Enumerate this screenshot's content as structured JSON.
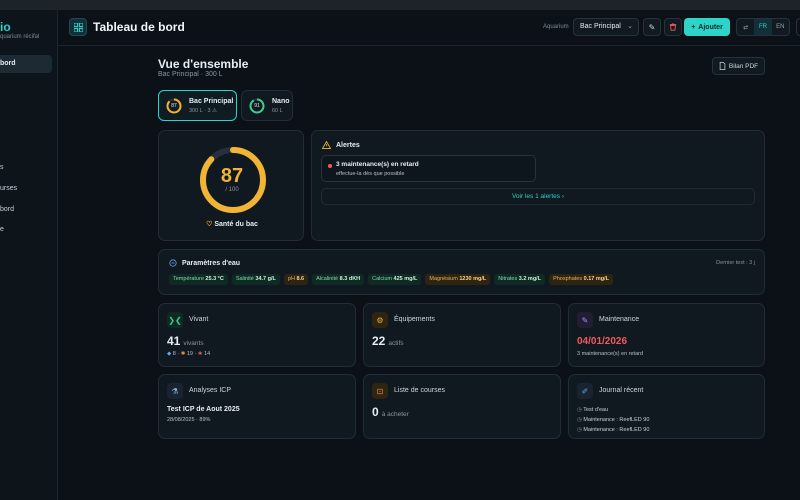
{
  "sidebar": {
    "brand": "io",
    "brand_sub": "quarium récifal",
    "items": [
      "bord",
      "",
      "s",
      "urses",
      "bord",
      "e"
    ]
  },
  "header": {
    "title": "Tableau de bord",
    "aquarium_label": "Aquarium",
    "aquarium_selected": "Bac Principal",
    "add_label": "Ajouter",
    "lang_fr": "FR",
    "lang_en": "EN"
  },
  "overview": {
    "title": "Vue d'ensemble",
    "subtitle": "Bac Principal · 300 L",
    "pdf_label": "Bilan PDF"
  },
  "tanks": [
    {
      "score": "87",
      "name": "Bac Principal",
      "meta": "300 L · 3 ⚠",
      "score_fraction": 0.87,
      "color": "#f2b434"
    },
    {
      "score": "91",
      "name": "Nano",
      "meta": "60 L",
      "score_fraction": 0.91,
      "color": "#3ecf8e"
    }
  ],
  "health": {
    "score": "87",
    "max": "/ 100",
    "score_fraction": 0.87,
    "label": "Santé du bac",
    "color": "#f2b434"
  },
  "alerts": {
    "title": "Alertes",
    "item_title": "3 maintenance(s) en retard",
    "item_sub": "effectue-la dès que possible",
    "link": "Voir les 1 alertes"
  },
  "params": {
    "title": "Paramètres d'eau",
    "last_test": "Dernier test : 3 j",
    "chips": [
      {
        "label": "Température",
        "value": "25.3 °C",
        "status": "ok"
      },
      {
        "label": "Salinité",
        "value": "34.7 g/L",
        "status": "ok"
      },
      {
        "label": "pH",
        "value": "8.6",
        "status": "warn"
      },
      {
        "label": "Alcalinité",
        "value": "8.3 dKH",
        "status": "ok"
      },
      {
        "label": "Calcium",
        "value": "425 mg/L",
        "status": "ok"
      },
      {
        "label": "Magnésium",
        "value": "1230 mg/L",
        "status": "warn"
      },
      {
        "label": "Nitrates",
        "value": "3.2 mg/L",
        "status": "ok"
      },
      {
        "label": "Phosphates",
        "value": "0.17 mg/L",
        "status": "warn"
      }
    ]
  },
  "tiles": {
    "vivant": {
      "title": "Vivant",
      "count": "41",
      "unit": "vivants",
      "fish": "8",
      "inverts": "19",
      "corals": "14"
    },
    "equipements": {
      "title": "Équipements",
      "count": "22",
      "unit": "actifs"
    },
    "maintenance": {
      "title": "Maintenance",
      "date": "04/01/2026",
      "sub": "3 maintenance(s) en retard"
    },
    "icp": {
      "title": "Analyses ICP",
      "name": "Test ICP de Aout 2025",
      "sub": "28/08/2025 · 89%"
    },
    "courses": {
      "title": "Liste de courses",
      "count": "0",
      "unit": "à acheter"
    },
    "journal": {
      "title": "Journal récent",
      "entries": [
        "Test d'eau",
        "Maintenance : ReefLED 90",
        "Maintenance : ReefLED 90"
      ]
    }
  }
}
